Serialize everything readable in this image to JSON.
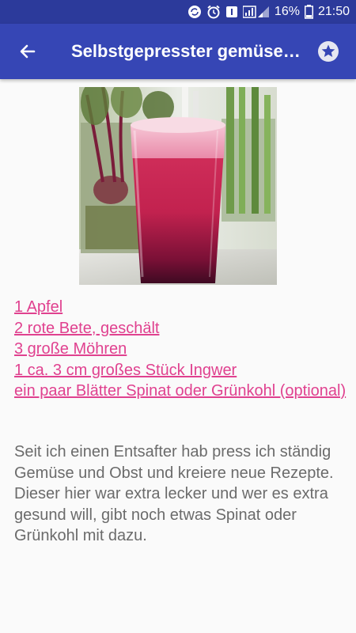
{
  "status_bar": {
    "battery_percent": "16%",
    "time": "21:50",
    "icons": [
      "sync-icon",
      "alarm-icon",
      "notification-icon",
      "signal-icon",
      "battery-icon"
    ]
  },
  "app_bar": {
    "title": "Selbstgepresster gemüse smoothie",
    "back_icon": "arrow-left-icon",
    "favorite_icon": "star-icon",
    "color": "#3646b5",
    "status_color": "#2c3a9b"
  },
  "recipe": {
    "image_icon": "smoothie-photo",
    "ingredients": [
      "1 Apfel",
      "2 rote Bete, geschält",
      "3 große Möhren",
      "1 ca. 3 cm großes Stück Ingwer",
      "ein paar Blätter Spinat oder Grünkohl (optional)"
    ],
    "description": "Seit ich einen Entsafter hab press ich ständig Gemüse und Obst und kreiere neue Rezepte. Dieser hier war extra lecker und wer es extra gesund will, gibt noch etwas Spinat oder Grünkohl mit dazu.",
    "link_color": "#e0418f",
    "text_color": "#6b6b6b"
  }
}
